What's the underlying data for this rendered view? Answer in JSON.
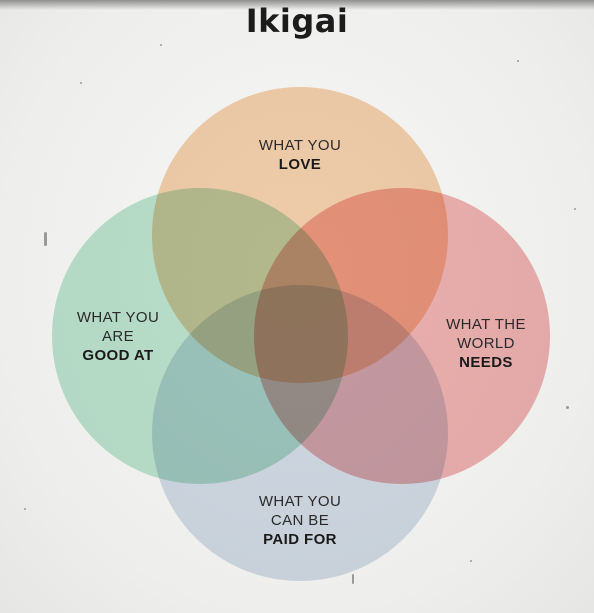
{
  "title": "Ikigai",
  "diagram": {
    "circles": [
      {
        "id": "love",
        "color": "#f5c79a",
        "label_lines": [
          "WHAT YOU"
        ],
        "label_bold": "LOVE"
      },
      {
        "id": "good-at",
        "color": "#a9dfc4",
        "label_lines": [
          "WHAT YOU",
          "ARE"
        ],
        "label_bold": "GOOD AT"
      },
      {
        "id": "world-needs",
        "color": "#ef9c9c",
        "label_lines": [
          "WHAT THE",
          "WORLD"
        ],
        "label_bold": "NEEDS"
      },
      {
        "id": "paid-for",
        "color": "#cbd6e6",
        "label_lines": [
          "WHAT YOU",
          "CAN BE"
        ],
        "label_bold": "PAID FOR"
      }
    ]
  }
}
